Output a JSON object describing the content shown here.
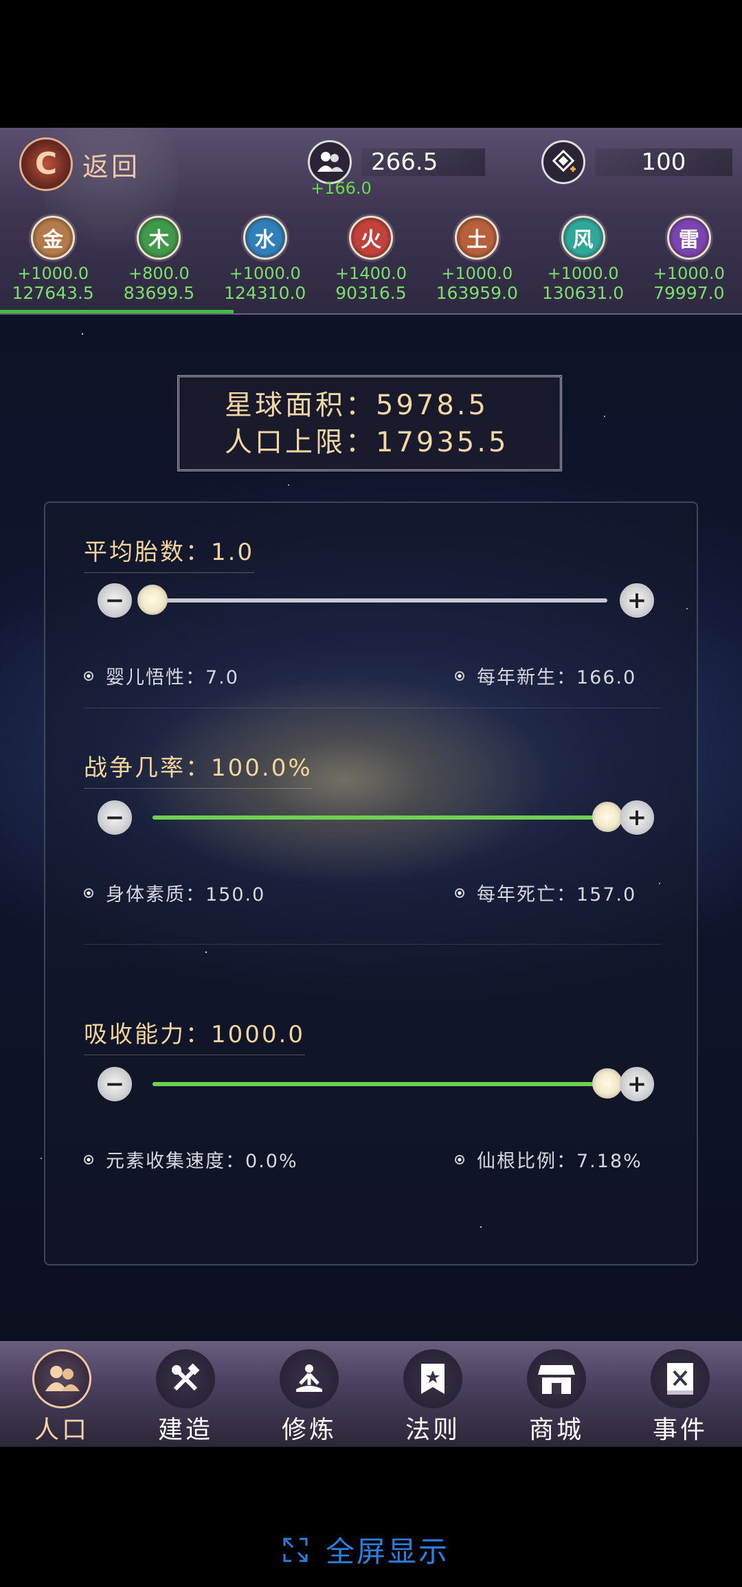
{
  "topbar": {
    "back_label": "返回",
    "population": {
      "value": "266.5",
      "delta": "+166.0"
    },
    "gems": {
      "value": "100"
    }
  },
  "elements": [
    {
      "name": "金",
      "delta": "+1000.0",
      "total": "127643.5",
      "color": "#b47a4a"
    },
    {
      "name": "木",
      "delta": "+800.0",
      "total": "83699.5",
      "color": "#3f9a4a"
    },
    {
      "name": "水",
      "delta": "+1000.0",
      "total": "124310.0",
      "color": "#2f7fb8"
    },
    {
      "name": "火",
      "delta": "+1400.0",
      "total": "90316.5",
      "color": "#c0423a"
    },
    {
      "name": "土",
      "delta": "+1000.0",
      "total": "163959.0",
      "color": "#b8603a"
    },
    {
      "name": "风",
      "delta": "+1000.0",
      "total": "130631.0",
      "color": "#2fa89a"
    },
    {
      "name": "雷",
      "delta": "+1000.0",
      "total": "79997.0",
      "color": "#7a45b0"
    }
  ],
  "planet": {
    "area_line": "星球面积：5978.5",
    "limit_line": "人口上限：17935.5"
  },
  "settings": [
    {
      "title": "平均胎数：1.0",
      "level": 0.0,
      "left_info": "婴儿悟性：7.0",
      "right_info": "每年新生：166.0"
    },
    {
      "title": "战争几率：100.0%",
      "level": 1.0,
      "left_info": "身体素质：150.0",
      "right_info": "每年死亡：157.0"
    },
    {
      "title": "吸收能力：1000.0",
      "level": 1.0,
      "left_info": "元素收集速度：0.0%",
      "right_info": "仙根比例：7.18%"
    }
  ],
  "nav": [
    {
      "label": "人口",
      "icon": "people-icon",
      "active": true
    },
    {
      "label": "建造",
      "icon": "tools-icon",
      "active": false
    },
    {
      "label": "修炼",
      "icon": "meditation-icon",
      "active": false
    },
    {
      "label": "法则",
      "icon": "law-banner-icon",
      "active": false
    },
    {
      "label": "商城",
      "icon": "shop-icon",
      "active": false
    },
    {
      "label": "事件",
      "icon": "event-book-icon",
      "active": false
    }
  ],
  "fullscreen_label": "全屏显示",
  "colors": {
    "accent_green": "#7be068",
    "title_gold": "#f3d49a",
    "link_blue": "#2b7fe0"
  }
}
